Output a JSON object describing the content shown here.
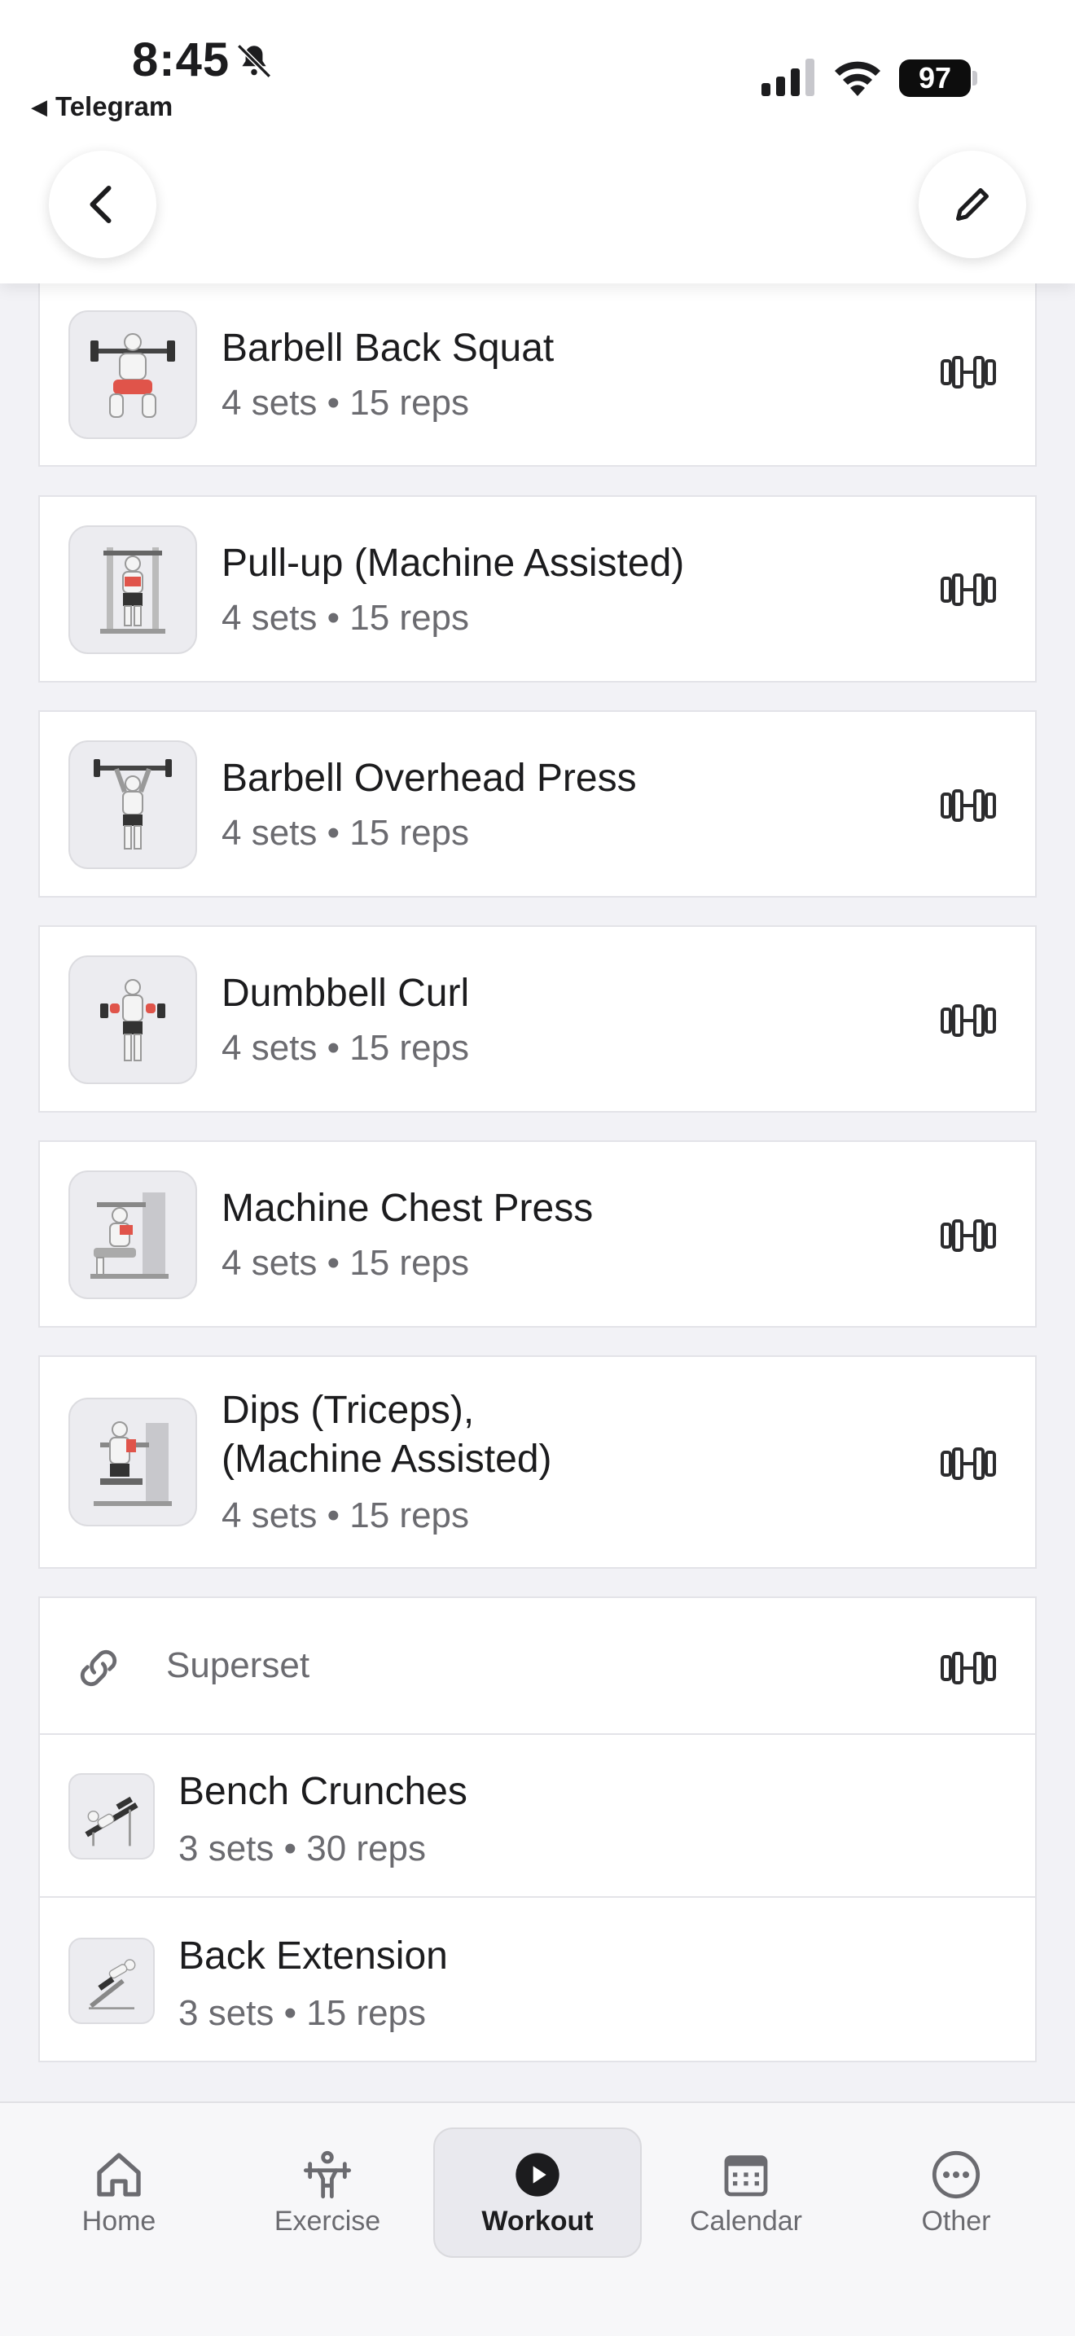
{
  "status_bar": {
    "time": "8:45",
    "back_app": "Telegram",
    "battery": "97"
  },
  "exercises": [
    {
      "name": "Barbell Back Squat",
      "meta": "4 sets • 15 reps"
    },
    {
      "name": "Pull-up (Machine Assisted)",
      "meta": "4 sets • 15 reps"
    },
    {
      "name": "Barbell Overhead Press",
      "meta": "4 sets • 15 reps"
    },
    {
      "name": "Dumbbell Curl",
      "meta": "4 sets • 15 reps"
    },
    {
      "name": "Machine Chest Press",
      "meta": "4 sets • 15 reps"
    },
    {
      "name_line1": "Dips (Triceps),",
      "name_line2": "(Machine Assisted)",
      "meta": "4 sets • 15 reps"
    }
  ],
  "superset": {
    "label": "Superset",
    "items": [
      {
        "name": "Bench Crunches",
        "meta": "3 sets • 30 reps"
      },
      {
        "name": "Back Extension",
        "meta": "3 sets • 15 reps"
      }
    ]
  },
  "tabs": [
    {
      "label": "Home",
      "icon": "home-icon"
    },
    {
      "label": "Exercise",
      "icon": "exercise-icon"
    },
    {
      "label": "Workout",
      "icon": "play-icon",
      "active": true
    },
    {
      "label": "Calendar",
      "icon": "calendar-icon"
    },
    {
      "label": "Other",
      "icon": "more-icon"
    }
  ],
  "colors": {
    "background": "#f2f2f6",
    "card": "#ffffff",
    "text_primary": "#1c1c1e",
    "text_secondary": "#6b6b70",
    "muscle_highlight": "#e0544a"
  }
}
